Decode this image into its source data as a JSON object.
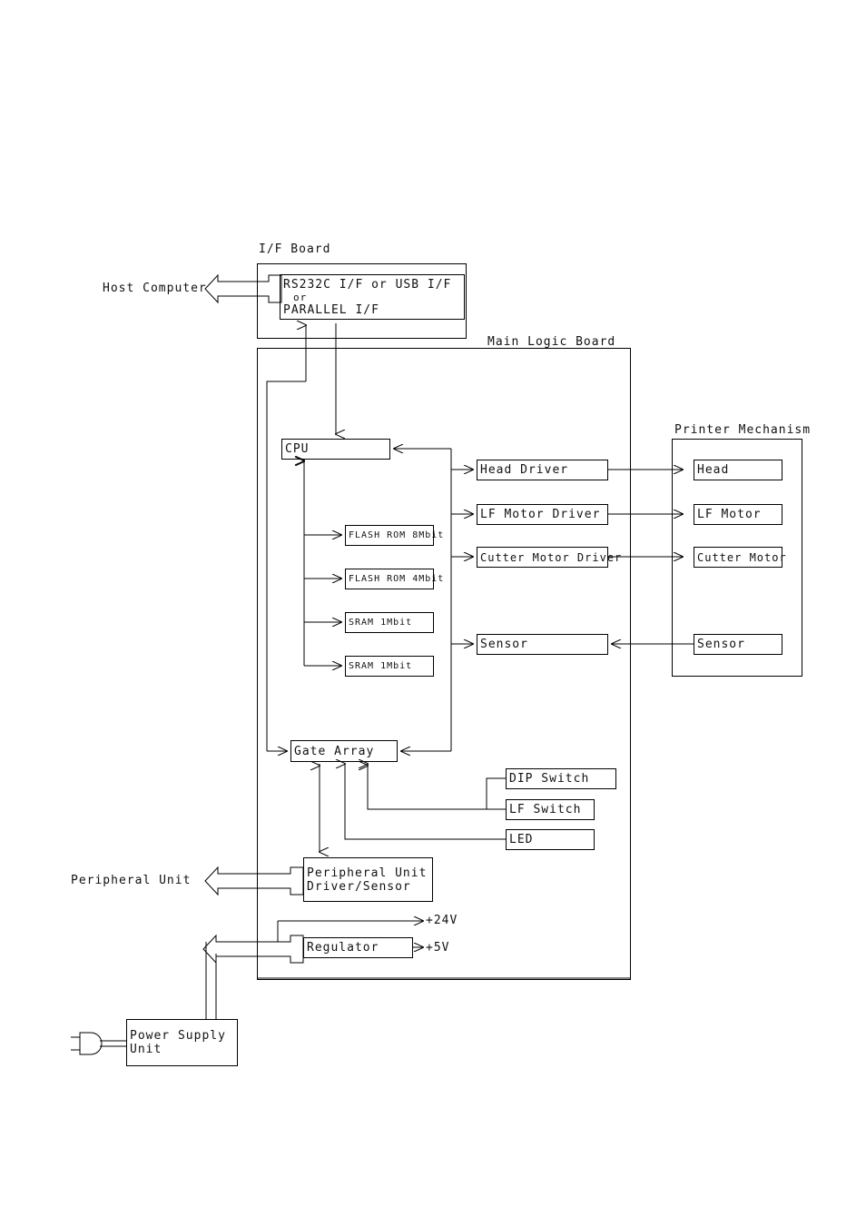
{
  "diagram": {
    "title_labels": {
      "if_board": "I/F Board",
      "main_logic_board": "Main Logic Board",
      "printer_mechanism": "Printer Mechanism"
    },
    "external": {
      "host_computer": "Host Computer",
      "peripheral_unit": "Peripheral Unit"
    },
    "if_board_block": {
      "line1": "RS232C I/F or USB I/F",
      "line2": "or",
      "line3": "PARALLEL I/F"
    },
    "main_logic": {
      "cpu": "CPU",
      "memories": [
        "FLASH ROM 8Mbit",
        "FLASH ROM 4Mbit",
        "SRAM 1Mbit",
        "SRAM 1Mbit"
      ],
      "drivers": [
        "Head Driver",
        "LF Motor Driver",
        "Cutter Motor Driver"
      ],
      "sensor": "Sensor",
      "gate_array": "Gate Array",
      "dip_switch": "DIP Switch",
      "lf_switch": "LF Switch",
      "led": "LED",
      "peripheral_driver_line1": "Peripheral Unit",
      "peripheral_driver_line2": "Driver/Sensor",
      "regulator": "Regulator"
    },
    "printer_mechanism_blocks": [
      "Head",
      "LF Motor",
      "Cutter Motor",
      "Sensor"
    ],
    "power": {
      "psu_line1": "Power Supply",
      "psu_line2": "Unit",
      "rail_24v": "+24V",
      "rail_5v": "+5V"
    },
    "colors": {
      "line": "#000000",
      "text": "#111111",
      "background": "#ffffff"
    }
  }
}
